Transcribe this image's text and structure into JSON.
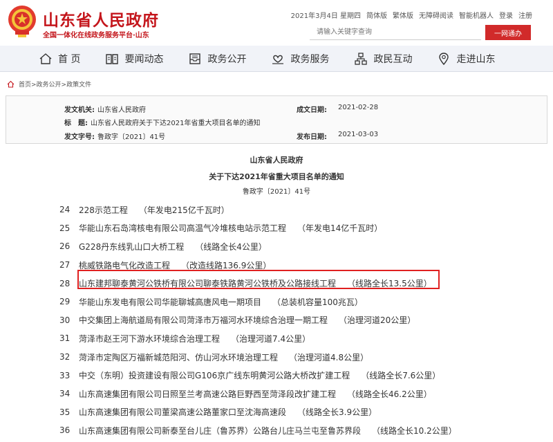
{
  "header": {
    "title": "山东省人民政府",
    "subtitle": "全国一体化在线政务服务平台·山东",
    "top_links": [
      "2021年3月4日 星期四",
      "简体版",
      "繁体版",
      "无障碍阅读",
      "智能机器人",
      "登录",
      "注册"
    ],
    "search_placeholder": "请输入关键字查询",
    "search_button": "一网通办"
  },
  "nav": {
    "items": [
      {
        "label": "首 页",
        "icon": "home-icon"
      },
      {
        "label": "要闻动态",
        "icon": "book-icon"
      },
      {
        "label": "政务公开",
        "icon": "inbox-icon"
      },
      {
        "label": "政务服务",
        "icon": "hand-heart-icon"
      },
      {
        "label": "政民互动",
        "icon": "network-icon"
      },
      {
        "label": "走进山东",
        "icon": "location-icon"
      }
    ]
  },
  "breadcrumb": "首页>政务公开>政策文件",
  "meta": {
    "issuer_label": "发文机关:",
    "issuer": "山东省人民政府",
    "date_label": "成文日期:",
    "date": "2021-02-28",
    "title_label": "标　题:",
    "title": "山东省人民政府关于下达2021年省重大项目名单的通知",
    "docno_label": "发文字号:",
    "docno": "鲁政字〔2021〕41号",
    "pub_label": "发布日期:",
    "pub_date": "2021-03-03"
  },
  "doc": {
    "org": "山东省人民政府",
    "title": "关于下达2021年省重大项目名单的通知",
    "number": "鲁政字〔2021〕41号"
  },
  "projects": [
    {
      "num": "24",
      "name": "228示范工程",
      "detail": "（年发电215亿千瓦时）"
    },
    {
      "num": "25",
      "name": "华能山东石岛湾核电有限公司高温气冷堆核电站示范工程",
      "detail": "（年发电14亿千瓦时）"
    },
    {
      "num": "26",
      "name": "G228丹东线乳山口大桥工程",
      "detail": "（线路全长4公里）"
    },
    {
      "num": "27",
      "name": "桃威铁路电气化改造工程",
      "detail": "（改造线路136.9公里）"
    },
    {
      "num": "28",
      "name": "山东建邦聊泰黄河公铁桥有限公司聊泰铁路黄河公铁桥及公路接线工程",
      "detail": "（线路全长13.5公里）"
    },
    {
      "num": "29",
      "name": "华能山东发电有限公司华能聊城高唐风电一期项目",
      "detail": "（总装机容量100兆瓦）"
    },
    {
      "num": "30",
      "name": "中交集团上海航道局有限公司菏泽市万福河水环境综合治理一期工程",
      "detail": "（治理河道20公里）"
    },
    {
      "num": "31",
      "name": "菏泽市赵王河下游水环境综合治理工程",
      "detail": "（治理河道7.4公里）"
    },
    {
      "num": "32",
      "name": "菏泽市定陶区万福新城范阳河、仿山河水环境治理工程",
      "detail": "（治理河道4.8公里）"
    },
    {
      "num": "33",
      "name": "中交（东明）投资建设有限公司G106京广线东明黄河公路大桥改扩建工程",
      "detail": "（线路全长7.6公里）"
    },
    {
      "num": "34",
      "name": "山东高速集团有限公司日照至兰考高速公路巨野西至菏泽段改扩建工程",
      "detail": "（线路全长46.2公里）"
    },
    {
      "num": "35",
      "name": "山东高速集团有限公司董梁高速公路董家口至沈海高速段",
      "detail": "（线路全长3.9公里）"
    },
    {
      "num": "36",
      "name": "山东高速集团有限公司新泰至台儿庄（鲁苏界）公路台儿庄马兰屯至鲁苏界段",
      "detail": "（线路全长10.2公里）"
    }
  ],
  "colors": {
    "brand_red": "#c4161c",
    "highlight_border": "#e02020",
    "nav_bg": "#f1f3f8"
  }
}
